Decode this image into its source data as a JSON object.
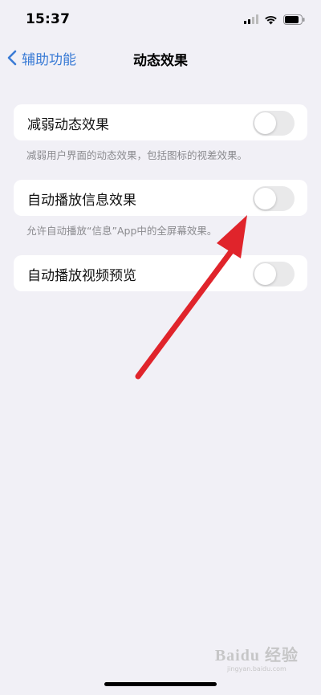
{
  "status_bar": {
    "time": "15:37"
  },
  "nav": {
    "back_label": "辅助功能",
    "title": "动态效果"
  },
  "settings": [
    {
      "label": "减弱动态效果",
      "on": false,
      "footer": "减弱用户界面的动态效果，包括图标的视差效果。"
    },
    {
      "label": "自动播放信息效果",
      "on": false,
      "footer": "允许自动播放“信息”App中的全屏幕效果。"
    },
    {
      "label": "自动播放视频预览",
      "on": false,
      "footer": ""
    }
  ],
  "annotation": {
    "arrow_color": "#e0242b"
  },
  "watermark": {
    "main": "Baidu 经验",
    "sub": "jingyan.baidu.com"
  },
  "colors": {
    "accent": "#3a7bd5",
    "background": "#f1f0f6",
    "toggle_off": "#e9e9ea"
  }
}
